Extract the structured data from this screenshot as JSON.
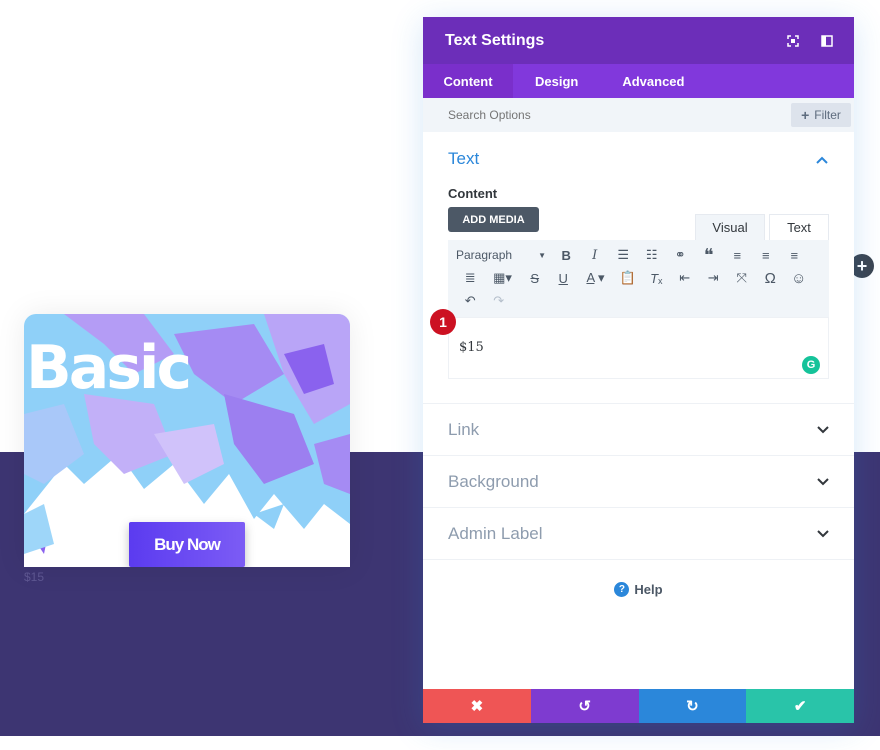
{
  "card": {
    "title": "Basic",
    "button_label": "Buy Now",
    "price_below": "$15"
  },
  "panel": {
    "title": "Text Settings",
    "tabs": [
      {
        "label": "Content"
      },
      {
        "label": "Design"
      },
      {
        "label": "Advanced"
      }
    ],
    "search_placeholder": "Search Options",
    "filter_label": "Filter",
    "text_section": {
      "title": "Text",
      "content_label": "Content",
      "add_media_label": "ADD MEDIA",
      "mode_visual": "Visual",
      "mode_text": "Text",
      "paragraph_select": "Paragraph",
      "editor_value": "$15",
      "annotation_number": "1"
    },
    "sections": [
      {
        "label": "Link"
      },
      {
        "label": "Background"
      },
      {
        "label": "Admin Label"
      }
    ],
    "help_label": "Help"
  },
  "colors": {
    "header": "#6c2eb9",
    "tabs": "#8138dc",
    "band": "#3d3572",
    "accent_blue": "#2b87da",
    "cancel": "#ef5555",
    "undo": "#7e3bd0",
    "redo": "#2b87da",
    "save": "#29c4a9"
  }
}
